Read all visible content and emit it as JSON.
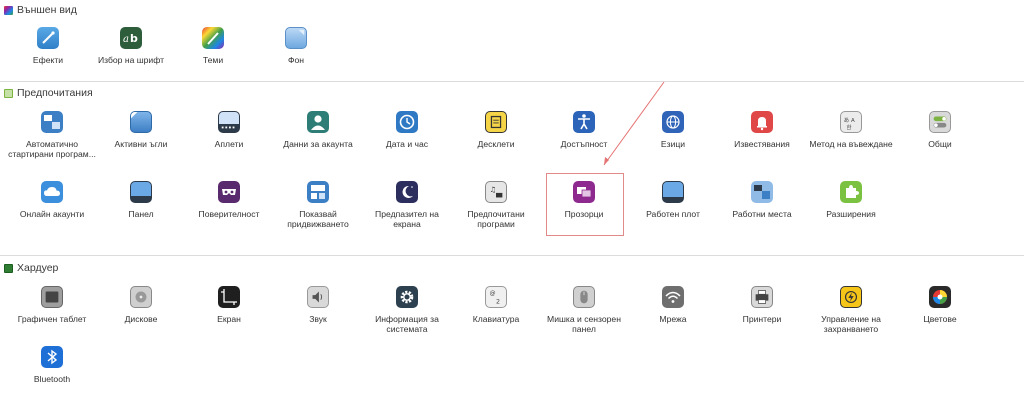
{
  "sections": {
    "appearance": {
      "title": "Външен вид",
      "color": "#c2185b"
    },
    "preferences": {
      "title": "Предпочитания",
      "color": "#7cb342"
    },
    "hardware": {
      "title": "Хардуер",
      "color": "#2e7d32"
    }
  },
  "appearance_items": [
    {
      "label": "Ефекти",
      "icon": "wand-icon"
    },
    {
      "label": "Избор на шрифт",
      "icon": "font-icon"
    },
    {
      "label": "Теми",
      "icon": "palette-icon"
    },
    {
      "label": "Фон",
      "icon": "wallpaper-icon"
    }
  ],
  "preferences_items": [
    {
      "label": "Автоматично стартирани програм...",
      "icon": "startup-icon"
    },
    {
      "label": "Активни ъгли",
      "icon": "hot-corners-icon"
    },
    {
      "label": "Аплети",
      "icon": "applets-icon"
    },
    {
      "label": "Данни за акаунта",
      "icon": "account-icon"
    },
    {
      "label": "Дата и час",
      "icon": "clock-icon"
    },
    {
      "label": "Десклети",
      "icon": "desklets-icon"
    },
    {
      "label": "Достъпност",
      "icon": "accessibility-icon"
    },
    {
      "label": "Езици",
      "icon": "languages-icon"
    },
    {
      "label": "Известявания",
      "icon": "bell-icon"
    },
    {
      "label": "Метод на въвеждане",
      "icon": "input-method-icon"
    },
    {
      "label": "Общи",
      "icon": "toggle-icon"
    },
    {
      "label": "Онлайн акаунти",
      "icon": "cloud-icon"
    },
    {
      "label": "Панел",
      "icon": "panel-icon"
    },
    {
      "label": "Поверителност",
      "icon": "mask-icon"
    },
    {
      "label": "Показвай придвижването",
      "icon": "windows-tile-icon"
    },
    {
      "label": "Предпазител на екрана",
      "icon": "moon-icon"
    },
    {
      "label": "Предпочитани програми",
      "icon": "media-icon"
    },
    {
      "label": "Прозорци",
      "icon": "windows-icon"
    },
    {
      "label": "Работен плот",
      "icon": "desktop-icon"
    },
    {
      "label": "Работни места",
      "icon": "workspaces-icon"
    },
    {
      "label": "Разширения",
      "icon": "puzzle-icon"
    }
  ],
  "hardware_items": [
    {
      "label": "Графичен таблет",
      "icon": "tablet-icon"
    },
    {
      "label": "Дискове",
      "icon": "disk-icon"
    },
    {
      "label": "Екран",
      "icon": "display-icon"
    },
    {
      "label": "Звук",
      "icon": "speaker-icon"
    },
    {
      "label": "Информация за системата",
      "icon": "gear-icon"
    },
    {
      "label": "Клавиатура",
      "icon": "keyboard-icon"
    },
    {
      "label": "Мишка и сензорен панел",
      "icon": "mouse-icon"
    },
    {
      "label": "Мрежа",
      "icon": "wifi-icon"
    },
    {
      "label": "Принтери",
      "icon": "printer-icon"
    },
    {
      "label": "Управление на захранването",
      "icon": "power-icon"
    },
    {
      "label": "Цветове",
      "icon": "colors-icon"
    },
    {
      "label": "Bluetooth",
      "icon": "bluetooth-icon"
    }
  ],
  "annotation": {
    "highlight_target": "Прозорци",
    "arrow_color": "#e57373"
  }
}
